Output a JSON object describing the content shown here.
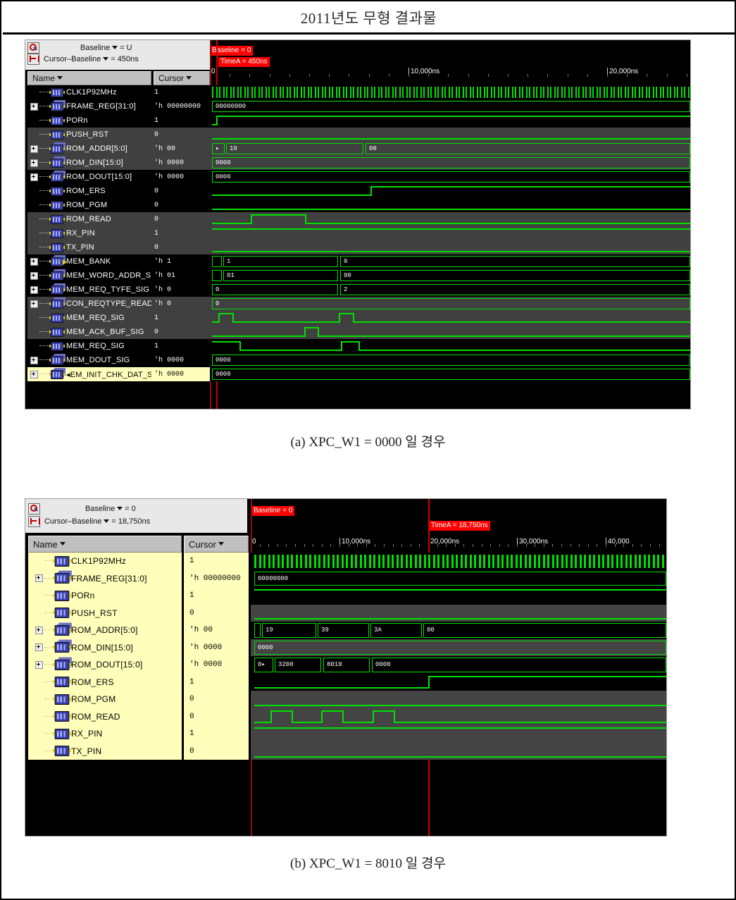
{
  "document": {
    "title": "2011년도 무형 결과물"
  },
  "figures": [
    {
      "id": "figure-a",
      "caption": "(a) XPC_W1 = 0000 일 경우",
      "header": {
        "baseline_icon": "magnifier-icon",
        "cursor_icon": "cursor-baseline-icon",
        "baseline_label": "Baseline",
        "baseline_value": "= U",
        "cursor_label": "Cursor–Baseline",
        "cursor_value": "= 450ns",
        "name_column": "Name",
        "cursor_column": "Cursor"
      },
      "wave_header": {
        "baseline_flag": "Baseline = 0",
        "timea_flag": "TimeA = 450ns",
        "ticks": [
          "0",
          "10,000ns",
          "20,000ns"
        ]
      },
      "signals": [
        {
          "name": "CLK1P92MHz",
          "value": "1",
          "expandable": false,
          "kind": "bit"
        },
        {
          "name": "FRAME_REG[31:0]",
          "value": "'h 00000000",
          "expandable": true,
          "kind": "bus"
        },
        {
          "name": "PORn",
          "value": "1",
          "expandable": false,
          "kind": "bit"
        },
        {
          "name": "PUSH_RST",
          "value": "0",
          "expandable": false,
          "kind": "bit"
        },
        {
          "name": "ROM_ADDR[5:0]",
          "value": "'h 00",
          "expandable": true,
          "kind": "bus"
        },
        {
          "name": "ROM_DIN[15:0]",
          "value": "'h 0000",
          "expandable": true,
          "kind": "bus"
        },
        {
          "name": "ROM_DOUT[15:0]",
          "value": "'h 0000",
          "expandable": true,
          "kind": "bus"
        },
        {
          "name": "ROM_ERS",
          "value": "0",
          "expandable": false,
          "kind": "bit"
        },
        {
          "name": "ROM_PGM",
          "value": "0",
          "expandable": false,
          "kind": "bit"
        },
        {
          "name": "ROM_READ",
          "value": "0",
          "expandable": false,
          "kind": "bit"
        },
        {
          "name": "RX_PIN",
          "value": "1",
          "expandable": false,
          "kind": "bit"
        },
        {
          "name": "TX_PIN",
          "value": "0",
          "expandable": false,
          "kind": "bit"
        },
        {
          "name": "MEM_BANK",
          "value": "'h 1",
          "expandable": true,
          "kind": "arrow"
        },
        {
          "name": "MEM_WORD_ADDR_SIG",
          "value": "'h 01",
          "expandable": true,
          "kind": "bus"
        },
        {
          "name": "MEM_REQ_TYFE_SIG",
          "value": "'h 0",
          "expandable": true,
          "kind": "bus"
        },
        {
          "name": "CON_REQTYPE_READ",
          "value": "'h 0",
          "expandable": true,
          "kind": "bus"
        },
        {
          "name": "MEM_REQ_SIG",
          "value": "1",
          "expandable": false,
          "kind": "bit"
        },
        {
          "name": "MEM_ACK_BUF_SIG",
          "value": "0",
          "expandable": false,
          "kind": "bit"
        },
        {
          "name": "MEM_REQ_SIG",
          "value": "1",
          "expandable": false,
          "kind": "bit"
        },
        {
          "name": "MEM_DOUT_SIG",
          "value": "'h 0000",
          "expandable": true,
          "kind": "bus"
        },
        {
          "name": "◂EM_INIT_CHK_DAT_SIG",
          "value": "'h 0000",
          "expandable": true,
          "kind": "bus",
          "selected": true
        }
      ],
      "wave_values": {
        "frame_reg": [
          "00000000"
        ],
        "rom_addr": [
          "19",
          "00"
        ],
        "rom_din": [
          "0000"
        ],
        "rom_dout": [
          "0000"
        ],
        "mem_bank": [
          "1",
          "0"
        ],
        "mem_word_addr": [
          "01",
          "00"
        ],
        "mem_req_type": [
          "0",
          "2"
        ],
        "con_reqtype_read": [
          "0"
        ],
        "mem_dout": [
          "0000"
        ],
        "mem_init_chk_dat": [
          "0000"
        ]
      }
    },
    {
      "id": "figure-b",
      "caption": "(b) XPC_W1 = 8010 일 경우",
      "header": {
        "baseline_icon": "magnifier-icon",
        "cursor_icon": "cursor-baseline-icon",
        "baseline_label": "Baseline",
        "baseline_value": "= 0",
        "cursor_label": "Cursor–Baseline",
        "cursor_value": "= 18,750ns",
        "name_column": "Name",
        "cursor_column": "Cursor"
      },
      "wave_header": {
        "baseline_flag": "Baseline = 0",
        "timea_flag": "TimeA = 18,750ns",
        "ticks": [
          "0",
          "10,000ns",
          "20,000ns",
          "30,000ns",
          "40,000"
        ]
      },
      "signals": [
        {
          "name": "CLK1P92MHz",
          "value": "1",
          "expandable": false,
          "kind": "bit"
        },
        {
          "name": "FRAME_REG[31:0]",
          "value": "'h 00000000",
          "expandable": true,
          "kind": "bus"
        },
        {
          "name": "PORn",
          "value": "1",
          "expandable": false,
          "kind": "bit"
        },
        {
          "name": "PUSH_RST",
          "value": "0",
          "expandable": false,
          "kind": "bit"
        },
        {
          "name": "ROM_ADDR[5:0]",
          "value": "'h 00",
          "expandable": true,
          "kind": "bus"
        },
        {
          "name": "ROM_DIN[15:0]",
          "value": "'h 0000",
          "expandable": true,
          "kind": "bus"
        },
        {
          "name": "ROM_DOUT[15:0]",
          "value": "'h 0000",
          "expandable": true,
          "kind": "bus"
        },
        {
          "name": "ROM_ERS",
          "value": "1",
          "expandable": false,
          "kind": "bit"
        },
        {
          "name": "ROM_PGM",
          "value": "0",
          "expandable": false,
          "kind": "bit"
        },
        {
          "name": "ROM_READ",
          "value": "0",
          "expandable": false,
          "kind": "bit"
        },
        {
          "name": "RX_PIN",
          "value": "1",
          "expandable": false,
          "kind": "bit"
        },
        {
          "name": "TX_PIN",
          "value": "0",
          "expandable": false,
          "kind": "bit"
        }
      ],
      "wave_values": {
        "frame_reg": [
          "00000000"
        ],
        "rom_addr": [
          "19",
          "39",
          "3A",
          "00"
        ],
        "rom_din": [
          "0000"
        ],
        "rom_dout": [
          "0▸",
          "3200",
          "8010",
          "0000"
        ]
      }
    }
  ],
  "colors": {
    "wave_green": "#00e000",
    "cursor_red": "#cc0000",
    "flag_red": "#ff0000",
    "pane_gray": "#c0c0c0",
    "selected_yellow": "#ffffbb",
    "row_dark": "#000000",
    "row_light": "#404040"
  }
}
